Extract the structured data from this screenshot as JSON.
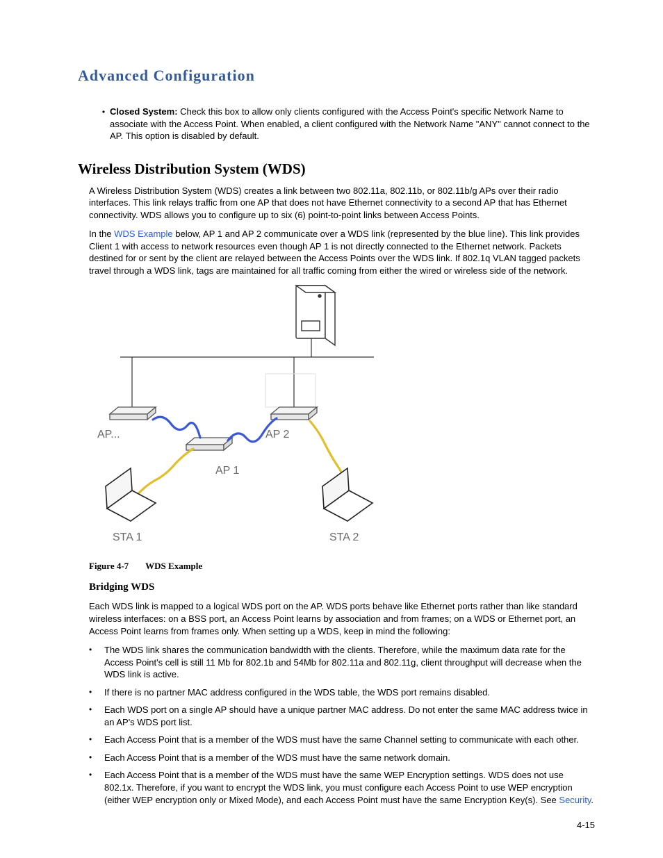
{
  "title": "Advanced Configuration",
  "closed_system": {
    "label": "Closed System:",
    "text": " Check this box to allow only clients configured with the Access Point's specific Network Name to associate with the Access Point. When enabled, a client configured with the Network Name \"ANY\" cannot connect to the AP. This option is disabled by default."
  },
  "wds": {
    "heading": "Wireless Distribution System (WDS)",
    "p1": "A Wireless Distribution System (WDS) creates a link between two 802.11a, 802.11b, or 802.11b/g APs over their radio interfaces. This link relays traffic from one AP that does not have Ethernet connectivity to a second AP that has Ethernet connectivity. WDS allows you to configure up to six (6) point-to-point links between Access Points.",
    "p2_a": "In the ",
    "p2_link": "WDS Example",
    "p2_b": " below, AP 1 and AP 2 communicate over a WDS link (represented by the blue line). This link provides Client 1 with access to network resources even though AP 1 is not directly connected to the Ethernet network. Packets destined for or sent by the client are relayed between the Access Points over the WDS link. If 802.1q VLAN tagged packets travel through a WDS link, tags are maintained for all traffic coming from either the wired or wireless side of the network."
  },
  "figure": {
    "caption_label": "Figure 4-7",
    "caption_title": "WDS Example",
    "labels": {
      "ap_ell": "AP...",
      "ap1": "AP 1",
      "ap2": "AP 2",
      "sta1": "STA 1",
      "sta2": "STA 2"
    }
  },
  "bridging": {
    "heading": "Bridging WDS",
    "intro": "Each WDS link is mapped to a logical WDS port on the AP. WDS ports behave like Ethernet ports rather than like standard wireless interfaces: on a BSS port, an Access Point learns by association and from frames; on a WDS or Ethernet port, an Access Point learns from frames only. When setting up a WDS, keep in mind the following:",
    "items": [
      "The WDS link shares the communication bandwidth with the clients. Therefore, while the maximum data rate for the Access Point's cell is still 11 Mb for 802.1b and 54Mb for 802.11a and 802.11g, client throughput will decrease when the WDS link is active.",
      "If there is no partner MAC address configured in the WDS table, the WDS port remains disabled.",
      "Each WDS port on a single AP should have a unique partner MAC address. Do not enter the same MAC address twice in an AP's WDS port list.",
      "Each Access Point that is a member of the WDS must have the same Channel setting to communicate with each other.",
      "Each Access Point that is a member of the WDS must have the same network domain."
    ],
    "item_last_a": "Each Access Point that is a member of the WDS must have the same WEP Encryption settings. WDS does not use 802.1x. Therefore, if you want to encrypt the WDS link, you must configure each Access Point to use WEP encryption (either WEP encryption only or Mixed Mode), and each Access Point must have the same Encryption Key(s). See ",
    "item_last_link": "Security",
    "item_last_b": "."
  },
  "pagenum": "4-15"
}
